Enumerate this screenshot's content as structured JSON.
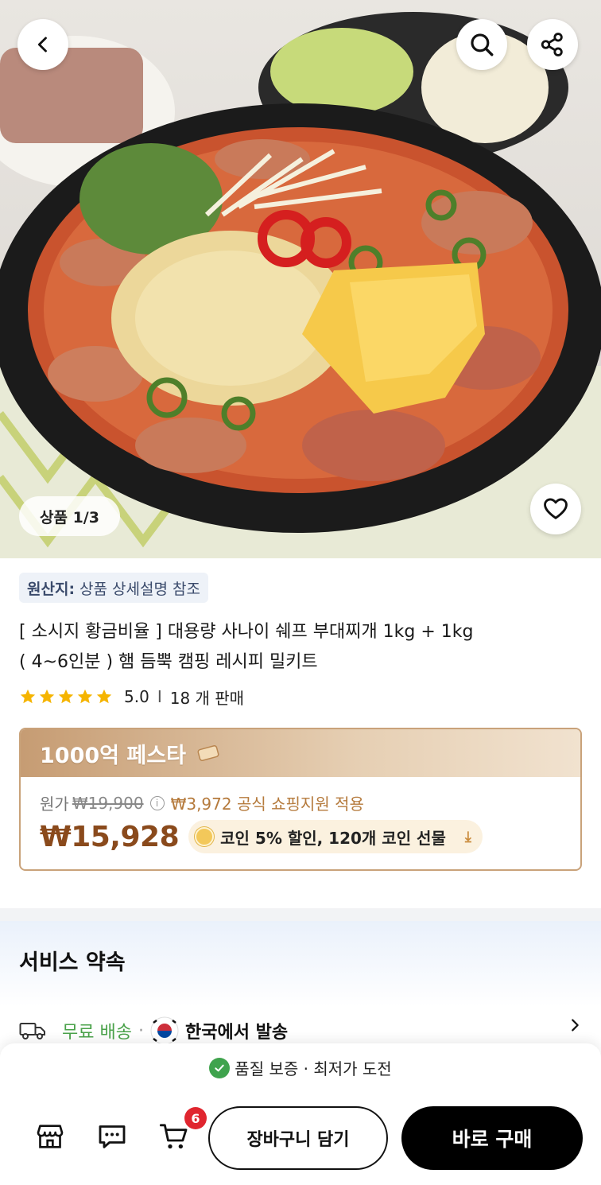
{
  "hero": {
    "page_indicator": "상품 1/3"
  },
  "product": {
    "origin_label": "원산지:",
    "origin_value": "상품 상세설명 참조",
    "title_line1": "[ 소시지 황금비율 ] 대용량 사나이 쉐프 부대찌개 1kg + 1kg",
    "title_line2": "( 4~6인분 ) 햄 듬뿍 캠핑 레시피 밀키트",
    "rating": "5.0",
    "rating_separator": "I",
    "sold": "18 개 판매",
    "star_count": 5
  },
  "price_card": {
    "festa_label": "1000억 페스타",
    "original_label": "원가",
    "original_price": "₩19,900",
    "promo_text": "₩3,972 공식 쇼핑지원 적용",
    "final_price": "₩15,928",
    "coin_text": "코인 5% 할인,  120개 코인 선물",
    "download_glyph": "⤓"
  },
  "service": {
    "title": "서비스 약속",
    "free_shipping": "무료 배송",
    "separator": "·",
    "ships_from": "한국에서 발송"
  },
  "bottom_bar": {
    "guarantee_text": "품질 보증 · 최저가 도전",
    "cart_badge": "6",
    "add_to_cart": "장바구니 담기",
    "buy_now": "바로 구매"
  },
  "colors": {
    "accent_brown": "#8a4a1c",
    "festa_gold": "#c69c73",
    "free_ship_green": "#4aa24a",
    "badge_red": "#e0262f",
    "buy_button": "#000000"
  },
  "icons": [
    "back-icon",
    "search-icon",
    "share-icon",
    "heart-icon",
    "star-icon",
    "info-icon",
    "coin-icon",
    "download-icon",
    "truck-icon",
    "korea-flag-icon",
    "chevron-right-icon",
    "check-icon",
    "store-icon",
    "chat-icon",
    "cart-icon"
  ]
}
